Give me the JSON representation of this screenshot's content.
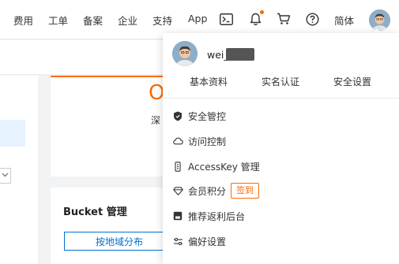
{
  "nav": {
    "fees": "费用",
    "tickets": "工单",
    "filing": "备案",
    "enterprise": "企业",
    "support": "支持",
    "app": "App",
    "language": "简体"
  },
  "background": {
    "card_big_char": "O",
    "card_sub_char": "深",
    "bucket_title": "Bucket 管理",
    "region_button": "按地域分布"
  },
  "dropdown": {
    "username": "wei_",
    "links": [
      "基本资料",
      "实名认证",
      "安全设置"
    ],
    "items": [
      {
        "label": "安全管控",
        "icon": "shield-icon"
      },
      {
        "label": "访问控制",
        "icon": "cloud-icon"
      },
      {
        "label": "AccessKey 管理",
        "icon": "key-icon"
      },
      {
        "label": "会员积分",
        "icon": "diamond-icon"
      },
      {
        "label": "推荐返利后台",
        "icon": "gift-icon"
      },
      {
        "label": "偏好设置",
        "icon": "sliders-icon"
      }
    ],
    "signin_label": "签到"
  },
  "colors": {
    "accent": "#ff6a00",
    "link": "#0070cc"
  }
}
